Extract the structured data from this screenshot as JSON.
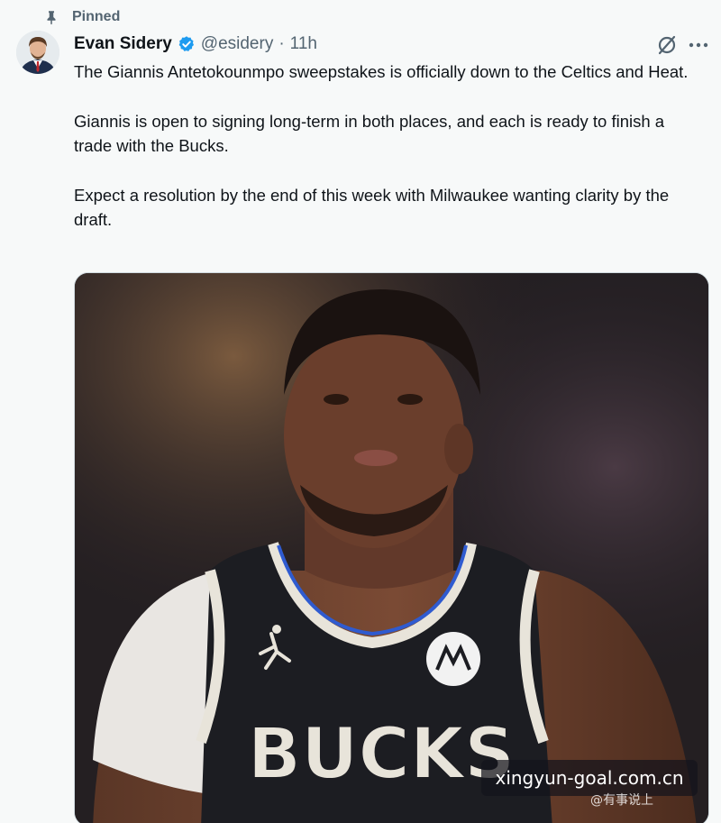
{
  "pinned": {
    "label": "Pinned"
  },
  "author": {
    "display_name": "Evan Sidery",
    "handle": "@esidery",
    "separator": "·",
    "timestamp": "11h",
    "verified_color": "#1d9bf0"
  },
  "tweet": {
    "paragraphs": [
      "The Giannis Antetokounmpo sweepstakes is officially down to the Celtics and Heat.",
      "Giannis is open to signing long-term in both places, and each is ready to finish a trade with the Bucks.",
      "Expect a resolution by the end of this week with Milwaukee wanting clarity by the draft."
    ]
  },
  "photo": {
    "jersey_text": "BUCKS"
  },
  "watermark": {
    "text": "xingyun-goal.com.cn",
    "sub_text": "@有事说上"
  },
  "icons": {
    "pin": "pin-icon",
    "verified": "verified-badge-icon",
    "grok": "grok-icon",
    "more": "more-icon"
  }
}
